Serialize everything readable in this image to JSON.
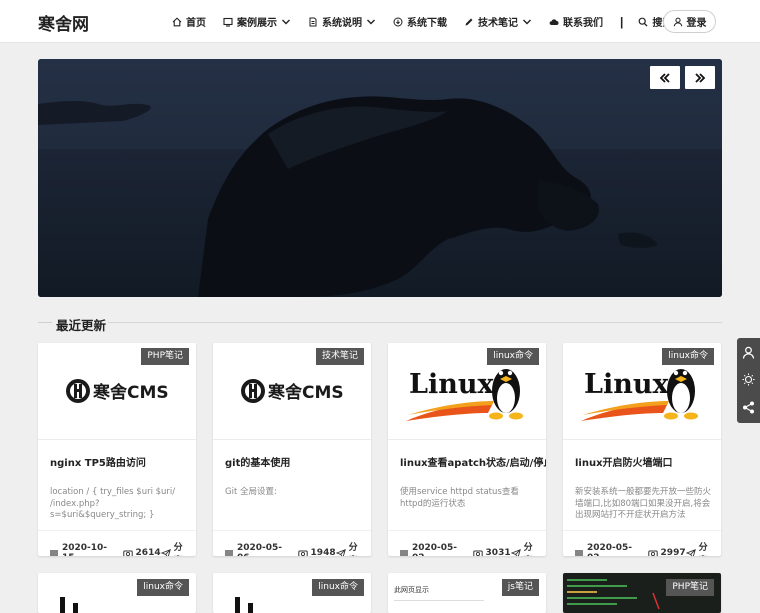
{
  "header": {
    "logo": "寒舍网",
    "nav": [
      {
        "label": "首页",
        "icon": "home-icon",
        "dropdown": false
      },
      {
        "label": "案例展示",
        "icon": "display-icon",
        "dropdown": true
      },
      {
        "label": "系统说明",
        "icon": "document-icon",
        "dropdown": true
      },
      {
        "label": "系统下载",
        "icon": "download-icon",
        "dropdown": false
      },
      {
        "label": "技术笔记",
        "icon": "pen-icon",
        "dropdown": true
      },
      {
        "label": "联系我们",
        "icon": "cloud-icon",
        "dropdown": false
      }
    ],
    "search_label": "搜索",
    "login_label": "登录"
  },
  "banner": {
    "prev_icon": "double-chevron-left-icon",
    "next_icon": "double-chevron-right-icon"
  },
  "section": {
    "title": "最近更新"
  },
  "cards": [
    {
      "tag": "PHP笔记",
      "title": "nginx TP5路由访问",
      "desc": "location / {         try_files $uri $uri/ /index.php?s=$uri&$query_string; }",
      "date": "2020-10-15",
      "views": "2614",
      "share": "分享",
      "thumb": "hancms",
      "logo_text": "寒舍CMS"
    },
    {
      "tag": "技术笔记",
      "title": "git的基本使用",
      "desc": "Git 全局设置:",
      "date": "2020-05-06",
      "views": "1948",
      "share": "分享",
      "thumb": "hancms",
      "logo_text": "寒舍CMS"
    },
    {
      "tag": "linux命令",
      "title": "linux查看apatch状态/启动/停止",
      "desc": "使用service httpd status查看httpd的运行状态",
      "date": "2020-05-02",
      "views": "3031",
      "share": "分享",
      "thumb": "linux",
      "logo_text": "Linux"
    },
    {
      "tag": "linux命令",
      "title": "linux开启防火墙端口",
      "desc": "新安装系统一般都要先开放一些防火墙端口,比如80端口如果没开启,将会出现网站打不开症状开启方法",
      "date": "2020-05-02",
      "views": "2997",
      "share": "分享",
      "thumb": "linux",
      "logo_text": "Linux"
    }
  ],
  "cards_row2": [
    {
      "tag": "linux命令"
    },
    {
      "tag": "linux命令"
    },
    {
      "tag": "js笔记",
      "thumb_text": "此网页显示"
    },
    {
      "tag": "PHP笔记"
    }
  ],
  "side": {
    "icons": [
      "user-icon",
      "sun-icon",
      "share-icon"
    ]
  }
}
